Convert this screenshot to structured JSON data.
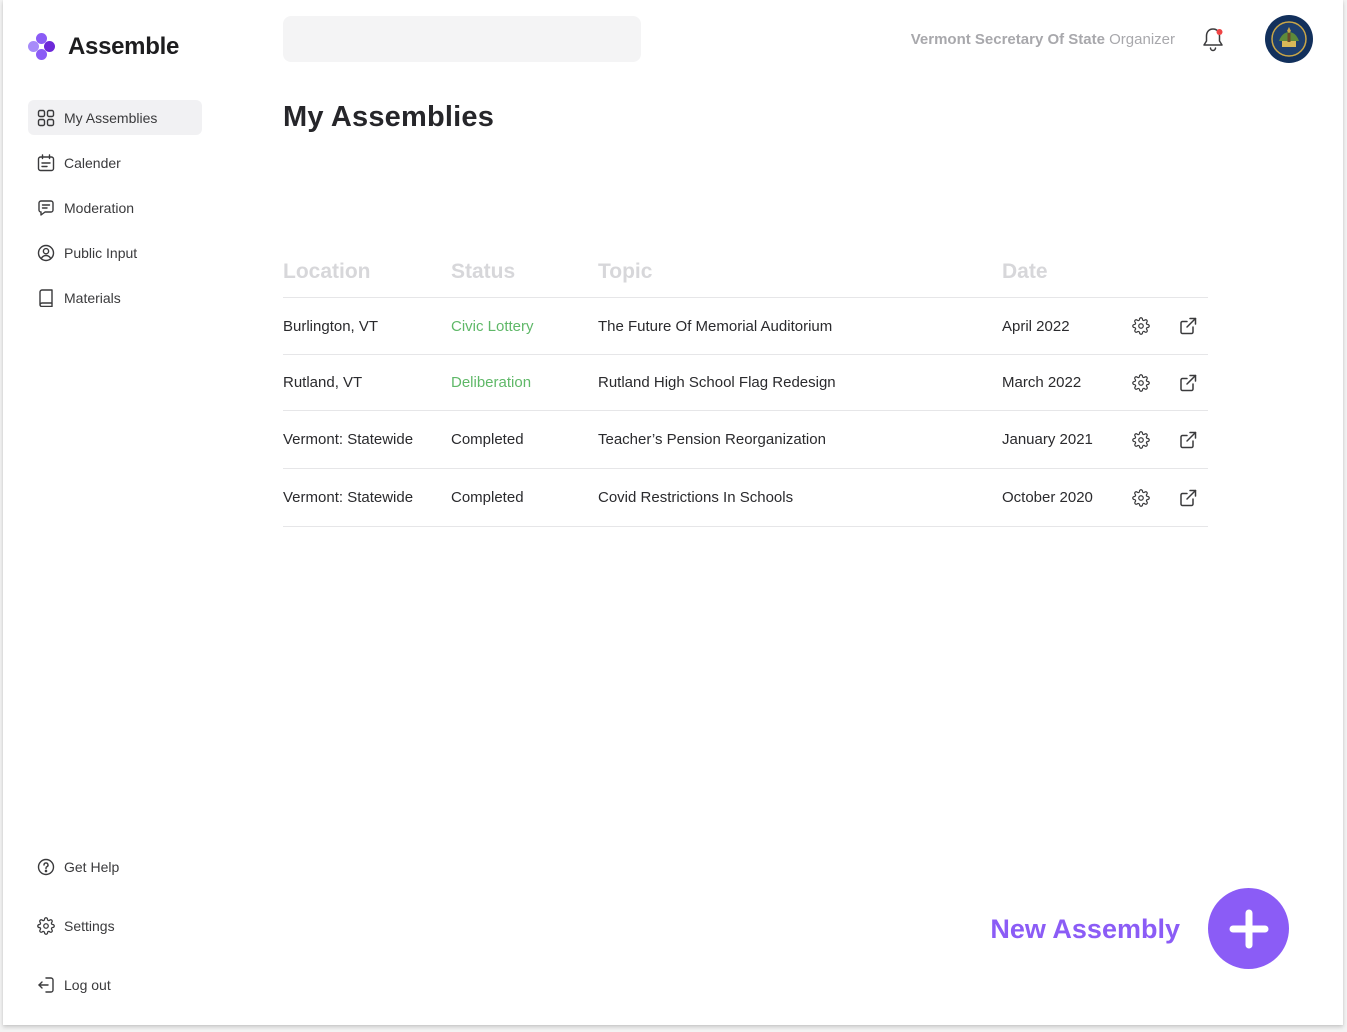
{
  "brand": {
    "name": "Assemble",
    "colors": [
      "#8b5cf6",
      "#a78bfa",
      "#6d28d9"
    ]
  },
  "sidebar": {
    "items": [
      {
        "label": "My Assemblies",
        "icon": "grid-icon",
        "active": true
      },
      {
        "label": "Calender",
        "icon": "calendar-icon"
      },
      {
        "label": "Moderation",
        "icon": "chat-icon"
      },
      {
        "label": "Public Input",
        "icon": "person-circle-icon"
      },
      {
        "label": "Materials",
        "icon": "book-icon"
      }
    ],
    "bottom_items": [
      {
        "label": "Get Help",
        "icon": "help-icon"
      },
      {
        "label": "Settings",
        "icon": "gear-icon"
      },
      {
        "label": "Log out",
        "icon": "logout-icon"
      }
    ]
  },
  "header": {
    "search_value": "",
    "org_name": "Vermont Secretary Of State",
    "role": "Organizer",
    "notification_dot_color": "#ef4444"
  },
  "main": {
    "title": "My Assemblies",
    "columns": [
      "Location",
      "Status",
      "Topic",
      "Date"
    ],
    "rows": [
      {
        "location": "Burlington, VT",
        "status": "Civic Lottery",
        "status_active": true,
        "topic": "The Future Of Memorial Auditorium",
        "date": "April 2022"
      },
      {
        "location": "Rutland, VT",
        "status": "Deliberation",
        "status_active": true,
        "topic": "Rutland High School Flag Redesign",
        "date": "March 2022"
      },
      {
        "location": "Vermont: Statewide",
        "status": "Completed",
        "status_active": false,
        "topic": "Teacher’s Pension Reorganization",
        "date": "January 2021"
      },
      {
        "location": "Vermont: Statewide",
        "status": "Completed",
        "status_active": false,
        "topic": "Covid Restrictions In Schools",
        "date": "October 2020"
      }
    ],
    "row_icons": [
      "gear-icon",
      "external-link-icon"
    ]
  },
  "new_assembly": {
    "label": "New Assembly",
    "icon": "plus-icon",
    "accent": "#8b5cf6"
  }
}
